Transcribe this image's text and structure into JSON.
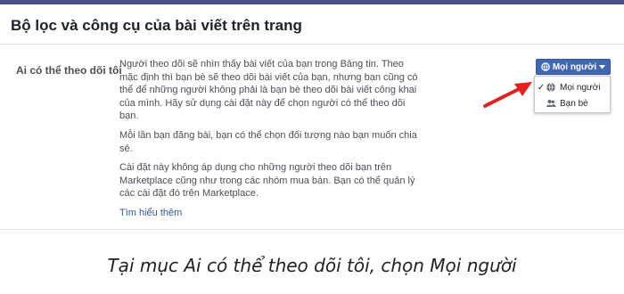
{
  "header": {
    "title": "Bộ lọc và công cụ của bài viết trên trang"
  },
  "setting": {
    "label": "Ai có thể theo dõi tôi",
    "paragraphs": [
      "Người theo dõi sẽ nhìn thấy bài viết của bạn trong Bảng tin. Theo mặc định thì bạn bè sẽ theo dõi bài viết của bạn, nhưng bạn cũng có thể để những người không phải là bạn bè theo dõi bài viết công khai của mình. Hãy sử dụng cài đặt này để chọn người có thể theo dõi bạn.",
      "Mỗi lần bạn đăng bài, bạn có thể chọn đối tượng nào bạn muốn chia sẻ.",
      "Cài đặt này không áp dụng cho những người theo dõi bạn trên Marketplace cũng như trong các nhóm mua bán. Bạn có thể quản lý các cài đặt đó trên Marketplace."
    ],
    "learn_more": "Tìm hiểu thêm"
  },
  "audience": {
    "selected_label": "Mọi người",
    "selected_icon": "globe-icon",
    "options": [
      {
        "label": "Mọi người",
        "icon": "globe-icon",
        "checked": true
      },
      {
        "label": "Bạn bè",
        "icon": "friends-icon",
        "checked": false
      }
    ]
  },
  "annotation": {
    "arrow_color": "#e0231f"
  },
  "caption": "Tại mục Ai có thể theo dõi tôi, chọn Mọi người"
}
